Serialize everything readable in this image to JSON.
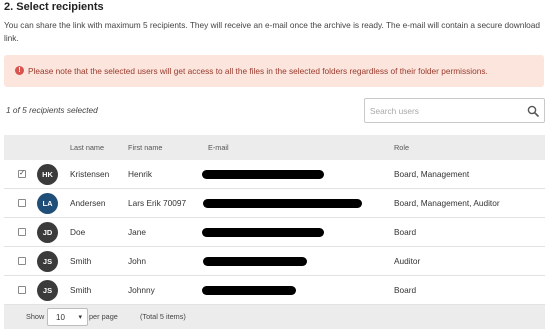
{
  "section": {
    "title": "2. Select recipients",
    "description": "You can share the link with maximum 5 recipients. They will receive an e-mail once the archive is ready. The e-mail will contain a secure download link."
  },
  "notice": {
    "icon": "exclamation-circle-icon",
    "text": "Please note that the selected users will get access to all the files in the selected folders regardless of their folder permissions.",
    "colors": {
      "background": "#fbe5dd",
      "icon": "#d9534f",
      "text": "#9a3a2b"
    }
  },
  "selection": {
    "count_text": "1 of 5 recipients selected"
  },
  "search": {
    "placeholder": "Search users",
    "value": "",
    "icon": "search-icon"
  },
  "table": {
    "headers": {
      "last_name": "Last name",
      "first_name": "First name",
      "email": "E-mail",
      "role": "Role"
    },
    "rows": [
      {
        "selected": true,
        "initials": "HK",
        "avatar_color": "#3b3b3b",
        "last_name": "Kristensen",
        "first_name": "Henrik",
        "email_redacted": true,
        "role": "Board, Management"
      },
      {
        "selected": false,
        "initials": "LA",
        "avatar_color": "#1f4e79",
        "last_name": "Andersen",
        "first_name": "Lars Erik 70097",
        "email_redacted": true,
        "role": "Board, Management, Auditor"
      },
      {
        "selected": false,
        "initials": "JD",
        "avatar_color": "#3b3b3b",
        "last_name": "Doe",
        "first_name": "Jane",
        "email_redacted": true,
        "role": "Board"
      },
      {
        "selected": false,
        "initials": "JS",
        "avatar_color": "#3b3b3b",
        "last_name": "Smith",
        "first_name": "John",
        "email_redacted": true,
        "role": "Auditor"
      },
      {
        "selected": false,
        "initials": "JS",
        "avatar_color": "#3b3b3b",
        "last_name": "Smith",
        "first_name": "Johnny",
        "email_redacted": true,
        "role": "Board"
      }
    ]
  },
  "pagination": {
    "show_label": "Show",
    "per_page_value": "10",
    "per_page_label": "per page",
    "total_text": "(Total 5 items)"
  }
}
